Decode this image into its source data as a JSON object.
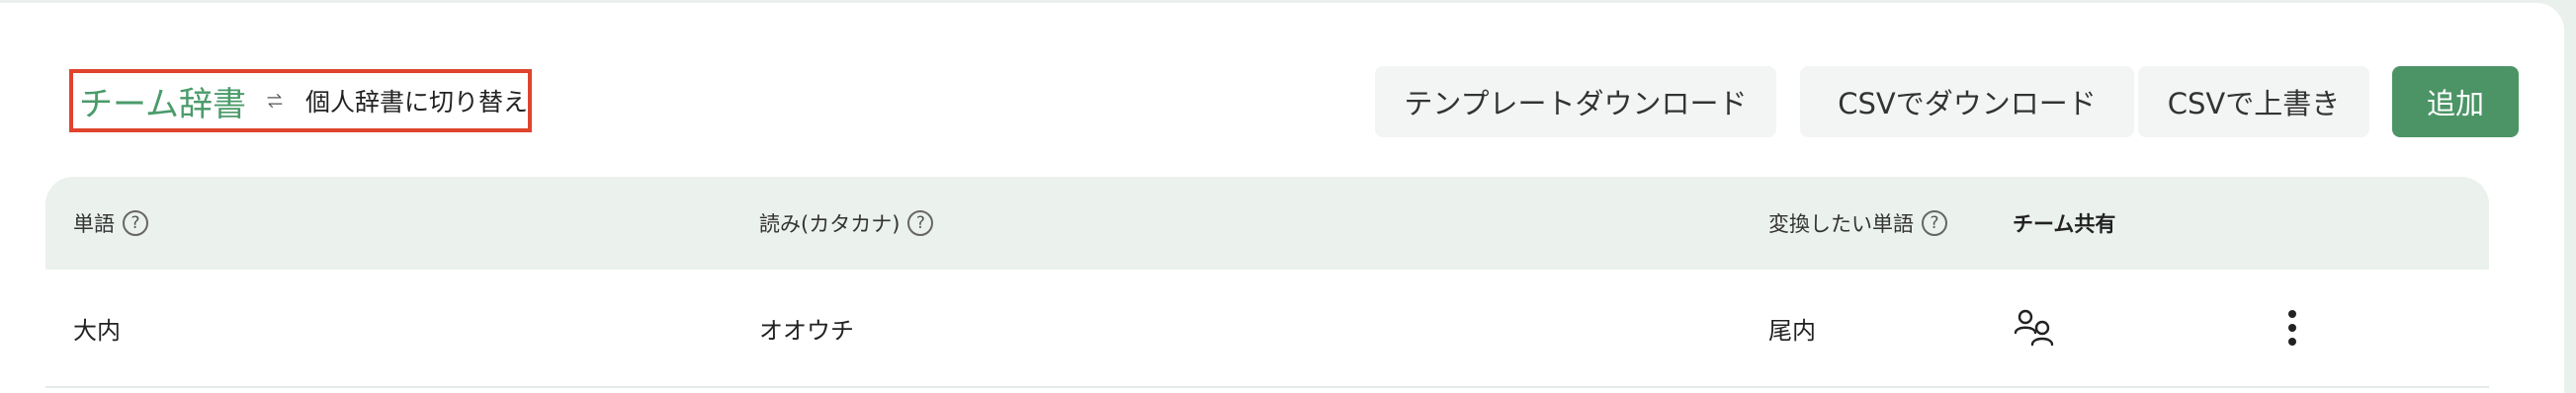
{
  "header": {
    "title": "チーム辞書",
    "switch_label": "個人辞書に切り替え",
    "swap_icon": "swap-arrows-icon"
  },
  "toolbar": {
    "template_download": "テンプレートダウンロード",
    "csv_download": "CSVでダウンロード",
    "csv_overwrite": "CSVで上書き",
    "add": "追加"
  },
  "table": {
    "columns": [
      {
        "label": "単語",
        "help": "?"
      },
      {
        "label": "読み(カタカナ)",
        "help": "?"
      },
      {
        "label": "変換したい単語",
        "help": "?"
      },
      {
        "label": "チーム共有"
      }
    ],
    "rows": [
      {
        "word": "大内",
        "reading": "オオウチ",
        "convert_to": "尾内",
        "shared_icon": "team-shared-icon",
        "menu_icon": "more-vertical-icon"
      }
    ]
  },
  "colors": {
    "accent": "#4a9b6a",
    "add_button": "#4c9466",
    "highlight_border": "#e0442e",
    "header_bg": "#ebf1ed"
  }
}
